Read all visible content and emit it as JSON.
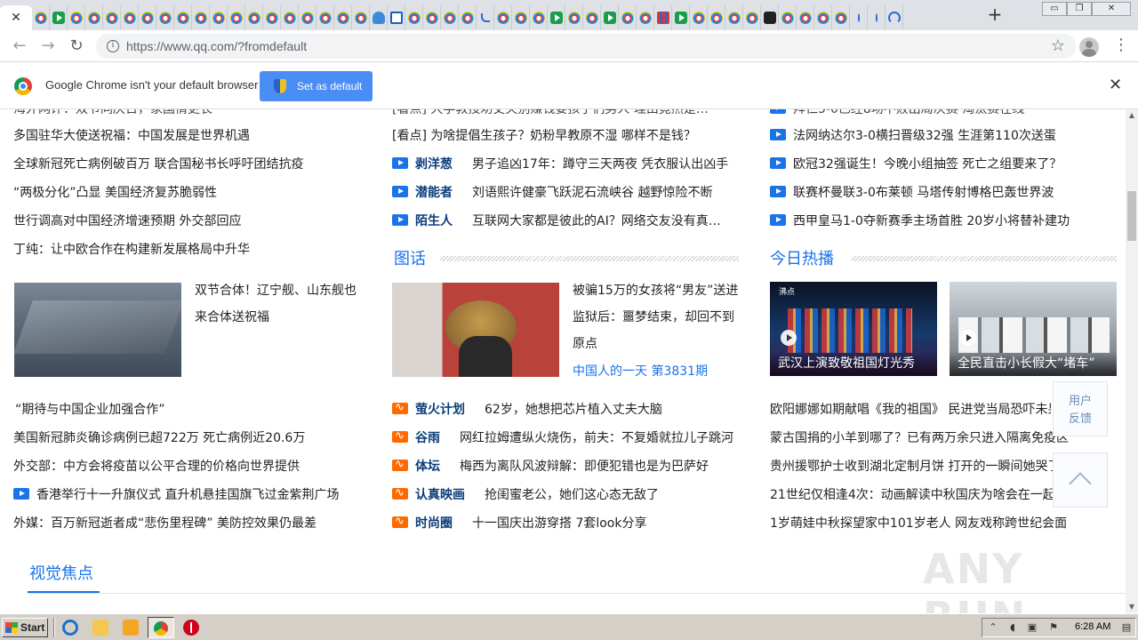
{
  "browser": {
    "url": "https://www.qq.com/?fromdefault",
    "new_tab_symbol": "+",
    "active_tab_close": "✕",
    "tab_favicons": [
      "qq",
      "play",
      "qq",
      "qq",
      "qq",
      "qq",
      "qq",
      "qq",
      "qq",
      "qq",
      "qq",
      "qq",
      "qq",
      "qq",
      "qq",
      "qq",
      "qq",
      "qq",
      "qq",
      "cloud",
      "house",
      "qq",
      "qq",
      "qq",
      "qq",
      "hook",
      "qq",
      "qq",
      "qq",
      "play",
      "qq",
      "qq",
      "play",
      "qq",
      "qq",
      "grid",
      "play",
      "qq",
      "qq",
      "qq",
      "qq",
      "dark",
      "qq",
      "qq",
      "qq",
      "qq",
      "line",
      "line",
      "spin"
    ],
    "window_controls": {
      "minimize": "▭",
      "restore": "❐",
      "close": "✕"
    },
    "back_symbol": "←",
    "forward_symbol": "→",
    "reload_symbol": "↻",
    "star_symbol": "☆",
    "menu_symbol": "⋮",
    "info_symbol": "i"
  },
  "infobar": {
    "message": "Google Chrome isn't your default browser",
    "button_label": "Set as default",
    "close_symbol": "✕"
  },
  "left_column": {
    "cut_line": "海外网评：双节同庆日，家国情更长",
    "news": [
      "多国驻华大使送祝福：中国发展是世界机遇",
      "全球新冠死亡病例破百万 联合国秘书长呼吁团结抗疫",
      "“两极分化”凸显 美国经济复苏脆弱性",
      "世行调高对中国经济增速预期 外交部回应",
      "丁纯：让中欧合作在构建新发展格局中升华"
    ],
    "feature": {
      "desc": "双节合体！辽宁舰、山东舰也来合体送祝福"
    },
    "news2": [
      "“期待与中国企业加强合作”",
      "美国新冠肺炎确诊病例已超722万 死亡病例近20.6万",
      "外交部：中方会将疫苗以公平合理的价格向世界提供",
      "香港举行十一升旗仪式 直升机悬挂国旗飞过金紫荆广场",
      "外媒：百万新冠逝者成“悲伤里程碑” 美防控效果仍最差"
    ]
  },
  "middle_column": {
    "cut_line": "[看点] 大学教授劝丈夫别赚钱要孩子们男人 理由竟然是…",
    "first": "[看点] 为啥提倡生孩子？奶粉早教原不湿 哪样不是钱？",
    "tagged": [
      {
        "tag": "剥洋葱",
        "text": "男子追凶17年：蹲守三天两夜 凭衣服认出凶手"
      },
      {
        "tag": "潜能者",
        "text": "刘语熙许健豪飞跃泥石流峡谷 越野惊险不断"
      },
      {
        "tag": "陌生人",
        "text": "互联网大家都是彼此的AI？网络交友没有真…"
      }
    ],
    "section_title": "图话",
    "feature": {
      "desc": "被骗15万的女孩将“男友”送进监狱后：噩梦结束，却回不到原点",
      "sub": "中国人的一天 第3831期"
    },
    "rss_items": [
      {
        "tag": "萤火计划",
        "text": "62岁，她想把芯片植入丈夫大脑"
      },
      {
        "tag": "谷雨",
        "text": "网红拉姆遭纵火烧伤，前夫：不复婚就拉儿子跳河"
      },
      {
        "tag": "体坛",
        "text": "梅西为离队风波辩解：即便犯错也是为巴萨好"
      },
      {
        "tag": "认真映画",
        "text": "抢闺蜜老公，她们这心态无敌了"
      },
      {
        "tag": "时尚圈",
        "text": "十一国庆出游穿搭 7套look分享"
      }
    ]
  },
  "right_column": {
    "cut_line": "拜仁5-0已经8场不败出局决赛 淘汰赛在线",
    "videos": [
      "法网纳达尔3-0横扫晋级32强 生涯第110次送蛋",
      "欧冠32强诞生！今晚小组抽签 死亡之组要来了？",
      "联赛杯曼联3-0布莱顿 马塔传射博格巴轰世界波",
      "西甲皇马1-0夺新赛季主场首胜 20岁小将替补建功"
    ],
    "section_title": "今日热播",
    "thumb1": {
      "logo": "沸点",
      "caption": "武汉上演致敬祖国灯光秀"
    },
    "thumb2": {
      "caption": "全民直击小长假大“堵车”"
    },
    "news": [
      "欧阳娜娜如期献唱《我的祖国》 民进党当局恐吓未果",
      "蒙古国捐的小羊到哪了？已有两万余只进入隔离免疫区",
      "贵州援鄂护士收到湖北定制月饼 打开的一瞬间她哭了",
      "21世纪仅相逢4次：动画解读中秋国庆为啥会在一起",
      "1岁萌娃中秋探望家中101岁老人 网友戏称跨世纪会面"
    ]
  },
  "feedback": {
    "line1": "用户",
    "line2": "反馈"
  },
  "focus_title": "视觉焦点",
  "watermark": "ANY  RUN",
  "taskbar": {
    "start_label": "Start",
    "clock": "6:28 AM"
  }
}
